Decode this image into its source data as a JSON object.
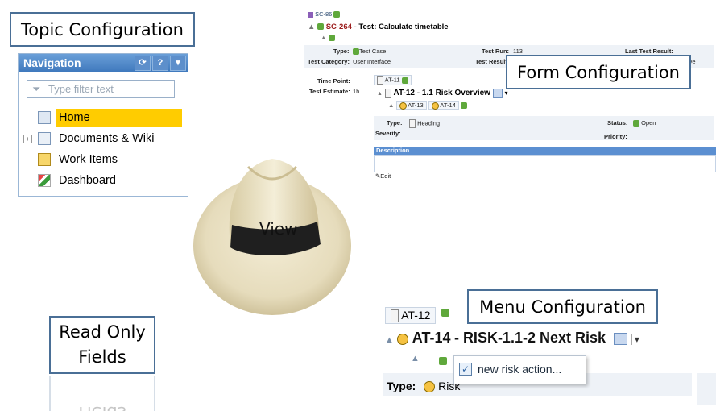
{
  "callouts": {
    "topic": "Topic Configuration",
    "form": "Form Configuration",
    "menu": "Menu Configuration",
    "readonly_line1": "Read Only",
    "readonly_line2": "Fields",
    "view": "View"
  },
  "navigation": {
    "title": "Navigation",
    "tools": [
      "refresh",
      "help",
      "menu"
    ],
    "filter_placeholder": "Type filter text",
    "items": [
      {
        "label": "Home",
        "icon": "home-page-icon",
        "selected": true
      },
      {
        "label": "Documents & Wiki",
        "icon": "documents-icon",
        "selected": false
      },
      {
        "label": "Work Items",
        "icon": "work-items-icon",
        "selected": false
      },
      {
        "label": "Dashboard",
        "icon": "dashboard-icon",
        "selected": false
      }
    ]
  },
  "form": {
    "parent_id": "SC-86",
    "item_id": "SC-264",
    "item_title": "Test: Calculate timetable",
    "type_label": "Type:",
    "type_value": "Test Case",
    "test_run_label": "Test Run:",
    "test_run_value": "113",
    "last_result_label": "Last Test Result:",
    "category_label": "Test Category:",
    "category_value": "User Interface",
    "test_result_label": "Test Result",
    "result_suffix": "ive",
    "time_point_label": "Time Point:",
    "time_point_value": "AT-11",
    "estimate_label": "Test Estimate:",
    "estimate_value": "1h",
    "linked_id": "AT-12",
    "linked_title": "1.1 Risk Overview",
    "child1": "AT-13",
    "child2": "AT-14",
    "sub_type_label": "Type:",
    "sub_type_value": "Heading",
    "status_label": "Status:",
    "status_value": "Open",
    "severity_label": "Severity:",
    "priority_label": "Priority:",
    "description_label": "Description",
    "edit_label": "Edit"
  },
  "menu": {
    "chip_id": "AT-12",
    "item_id": "AT-14",
    "item_title": "RISK-1.1-2 Next Risk",
    "popup_action": "new risk action...",
    "type_label": "Type:",
    "type_value": "Risk"
  }
}
